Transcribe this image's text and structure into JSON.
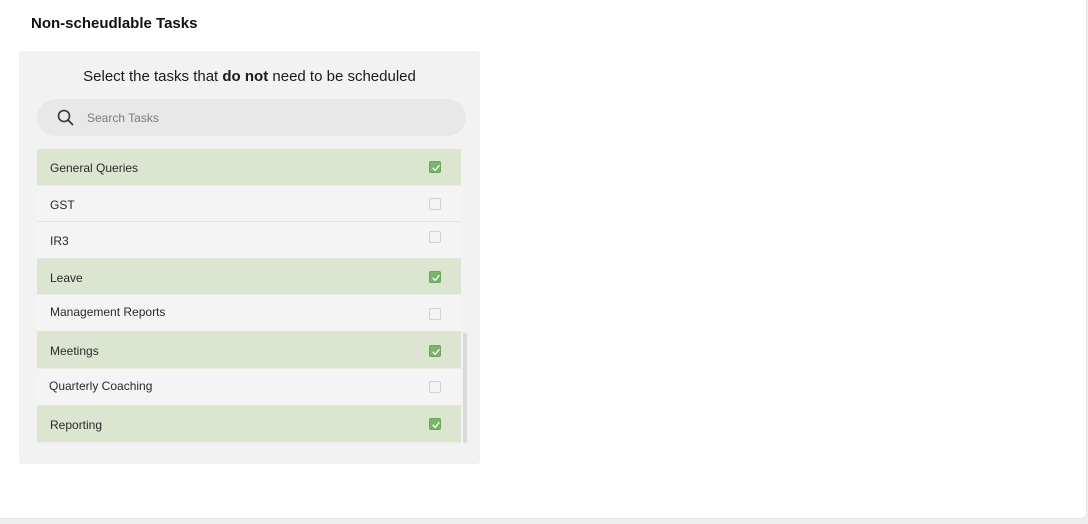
{
  "page": {
    "title": "Non-scheudlable Tasks"
  },
  "panel": {
    "instruction_prefix": "Select the tasks that ",
    "instruction_bold": "do not",
    "instruction_suffix": " need to be scheduled"
  },
  "search": {
    "placeholder": "Search Tasks",
    "icon": "search-icon"
  },
  "tasks": [
    {
      "label": "General Queries",
      "checked": true
    },
    {
      "label": "GST",
      "checked": false
    },
    {
      "label": "IR3",
      "checked": false
    },
    {
      "label": "Leave",
      "checked": true
    },
    {
      "label": "Management Reports",
      "checked": false
    },
    {
      "label": "Meetings",
      "checked": true
    },
    {
      "label": "Quarterly Coaching",
      "checked": false
    },
    {
      "label": "Reporting",
      "checked": true
    }
  ],
  "colors": {
    "checked_row": "#dbe5cf",
    "checkbox_on": "#7cb46a",
    "panel_bg": "#f2f2f2"
  }
}
